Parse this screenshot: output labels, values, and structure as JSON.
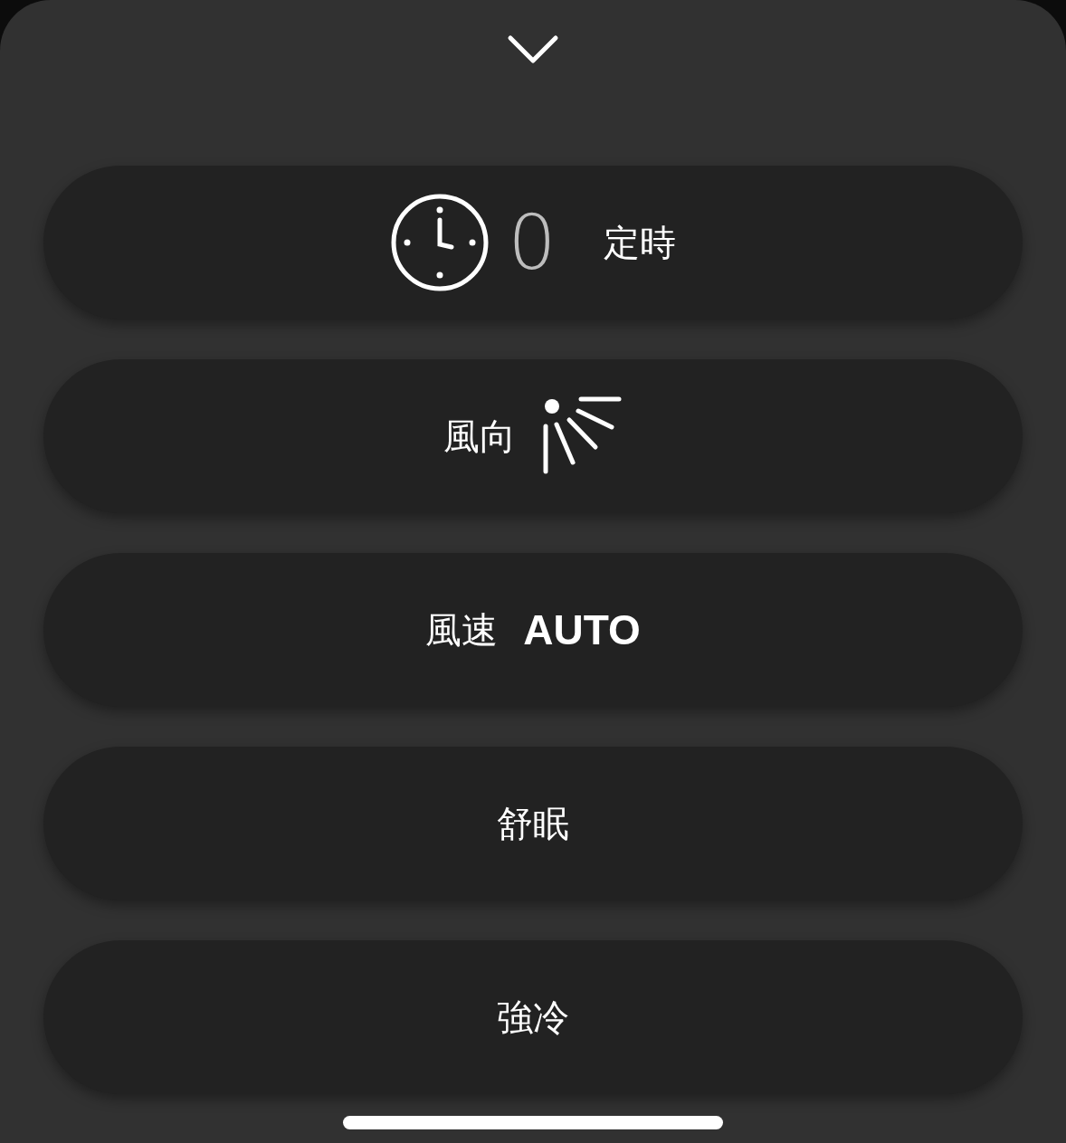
{
  "buttons": [
    {
      "kind": "timer",
      "count": "0",
      "label": "定時"
    },
    {
      "kind": "wind_direction",
      "label": "風向"
    },
    {
      "kind": "fan_speed",
      "label": "風速",
      "value": "AUTO"
    },
    {
      "kind": "plain",
      "label": "舒眠"
    },
    {
      "kind": "plain",
      "label": "強冷"
    }
  ]
}
